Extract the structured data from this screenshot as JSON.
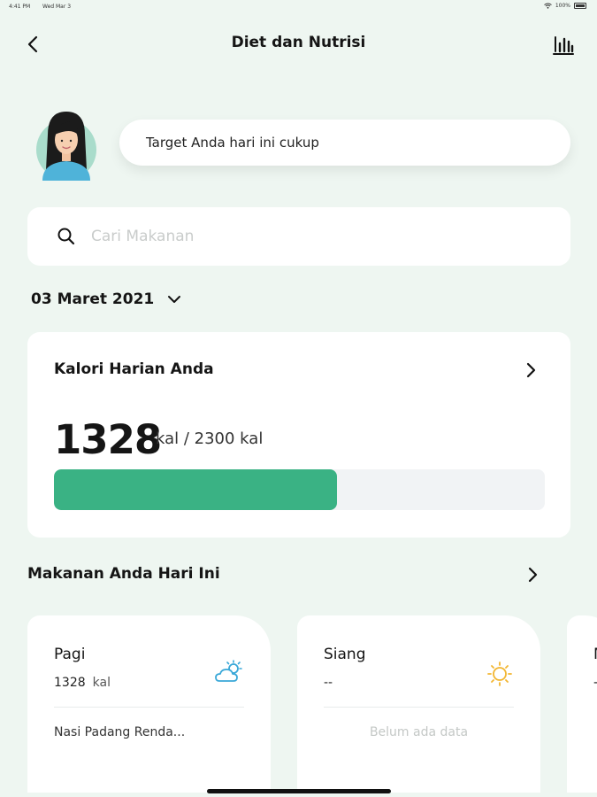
{
  "status_bar": {
    "time": "4:41 PM",
    "date": "Wed Mar 3",
    "battery": "100%"
  },
  "header": {
    "title": "Diet dan Nutrisi",
    "back_icon": "chevron-left-icon",
    "stats_icon": "bar-chart-icon"
  },
  "greeting": {
    "message": "Target Anda hari ini cukup"
  },
  "search": {
    "placeholder": "Cari Makanan",
    "value": ""
  },
  "date_selector": {
    "date": "03 Maret 2021"
  },
  "calorie_card": {
    "title": "Kalori Harian Anda",
    "consumed": "1328",
    "unit_label": "kal / 2300 kal",
    "progress_fraction": 0.577,
    "progress_color": "#3ab284"
  },
  "meals_section": {
    "title": "Makanan Anda Hari Ini",
    "meals": [
      {
        "name": "Pagi",
        "kcal": "1328",
        "unit": "kal",
        "food": "Nasi Padang Renda...",
        "icon": "cloud-sun-icon",
        "icon_color": "#3aa8d8"
      },
      {
        "name": "Siang",
        "kcal": "--",
        "empty_text": "Belum ada data",
        "icon": "sun-icon",
        "icon_color": "#f2b632"
      },
      {
        "name": "M",
        "kcal": "-"
      }
    ]
  }
}
